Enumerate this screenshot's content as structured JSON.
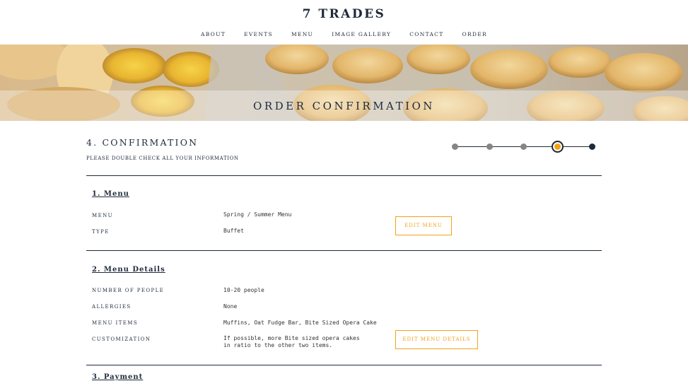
{
  "header": {
    "logo": "7 TRADES",
    "nav": [
      "ABOUT",
      "EVENTS",
      "MENU",
      "IMAGE GALLERY",
      "CONTACT",
      "ORDER"
    ]
  },
  "hero": {
    "title": "ORDER CONFIRMATION"
  },
  "step": {
    "title": "4. CONFIRMATION",
    "subtitle": "PLEASE DOUBLE CHECK ALL YOUR INFORMATION",
    "progress": {
      "total": 5,
      "current": 4
    }
  },
  "sections": {
    "menu": {
      "title": "1. Menu",
      "rows": [
        {
          "label": "MENU",
          "value": "Spring / Summer Menu"
        },
        {
          "label": "TYPE",
          "value": "Buffet"
        }
      ],
      "edit_label": "EDIT MENU"
    },
    "menu_details": {
      "title": "2. Menu Details",
      "rows": [
        {
          "label": "NUMBER OF PEOPLE",
          "value": "10-20 people"
        },
        {
          "label": "ALLERGIES",
          "value": "None"
        },
        {
          "label": "MENU ITEMS",
          "value": "Muffins, Oat Fudge Bar, Bite Sized Opera Cake"
        },
        {
          "label": "CUSTOMIZATION",
          "value": "If possible, more Bite sized opera cakes in ratio to the other two items."
        }
      ],
      "edit_label": "EDIT MENU DETAILS"
    },
    "payment": {
      "title": "3. Payment"
    }
  },
  "colors": {
    "navy": "#1e2a3a",
    "accent": "#f3a214",
    "inactive_dot": "#868686"
  }
}
